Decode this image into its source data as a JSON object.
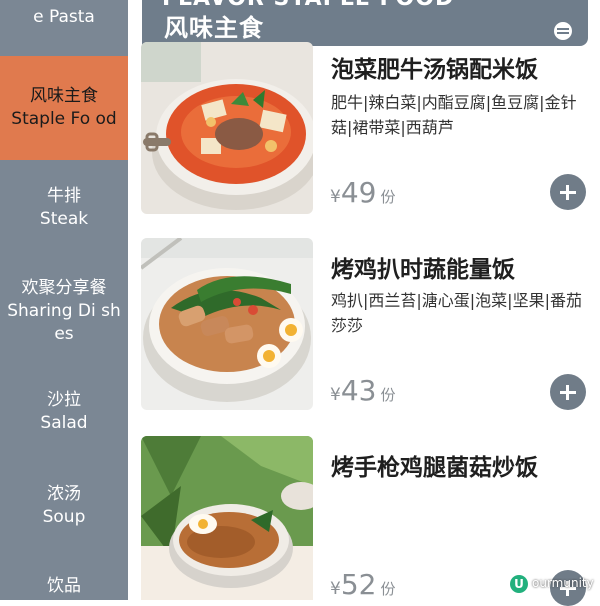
{
  "sidebar": {
    "items": [
      {
        "zh": "",
        "en": "e Pasta"
      },
      {
        "zh": "风味主食",
        "en": "Staple Fo od"
      },
      {
        "zh": "牛排",
        "en": "Steak"
      },
      {
        "zh": "欢聚分享餐",
        "en": "Sharing Di shes"
      },
      {
        "zh": "沙拉",
        "en": "Salad"
      },
      {
        "zh": "浓汤",
        "en": "Soup"
      },
      {
        "zh": "饮品",
        "en": ""
      }
    ],
    "active_index": 1,
    "active_color": "#e07a4e",
    "background_color": "#7b8794"
  },
  "category_header": {
    "en": "FLAVOR STAPLE FOOD",
    "zh": "风味主食",
    "collapse_icon": "collapse-icon"
  },
  "dishes": [
    {
      "name": "泡菜肥牛汤锅配米饭",
      "desc": "肥牛|辣白菜|内酯豆腐|鱼豆腐|金针菇|裙带菜|西葫芦",
      "currency": "¥",
      "price": "49",
      "unit": "份",
      "add_icon": "plus-icon"
    },
    {
      "name": "烤鸡扒时蔬能量饭",
      "desc": "鸡扒|西兰苔|溏心蛋|泡菜|坚果|番茄莎莎",
      "currency": "¥",
      "price": "43",
      "unit": "份",
      "add_icon": "plus-icon"
    },
    {
      "name": "烤手枪鸡腿菌菇炒饭",
      "desc": "",
      "currency": "¥",
      "price": "52",
      "unit": "份",
      "add_icon": "plus-icon"
    }
  ],
  "watermark": {
    "logo": "U",
    "text": "ourmunity"
  }
}
